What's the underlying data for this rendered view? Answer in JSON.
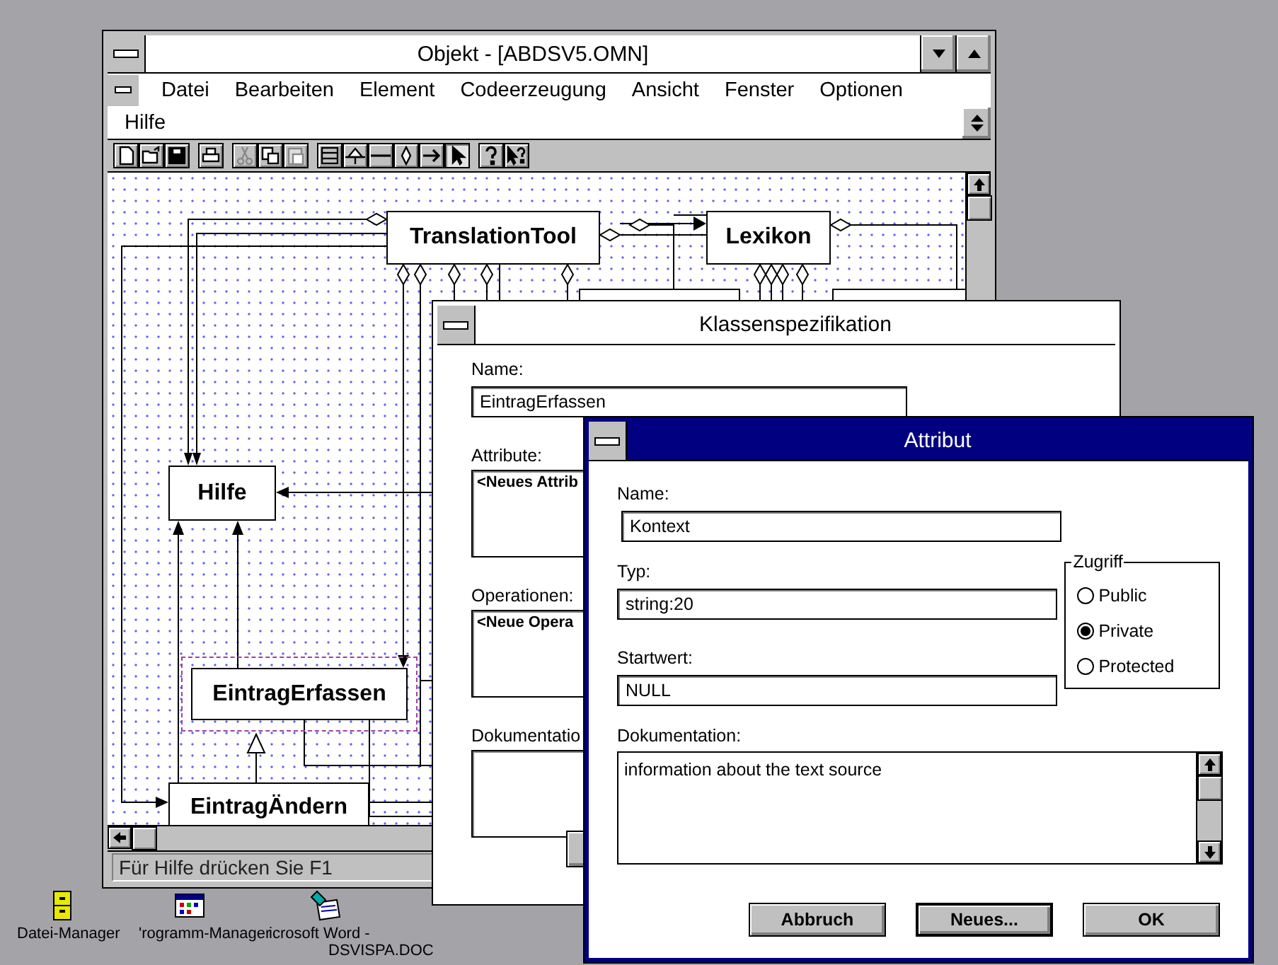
{
  "main_window": {
    "title": "Objekt - [ABDSV5.OMN]",
    "menu": [
      {
        "label": "Datei"
      },
      {
        "label": "Bearbeiten"
      },
      {
        "label": "Element"
      },
      {
        "label": "Codeerzeugung"
      },
      {
        "label": "Ansicht"
      },
      {
        "label": "Fenster"
      },
      {
        "label": "Optionen"
      },
      {
        "label": "Hilfe"
      }
    ],
    "toolbar": [
      [
        {
          "kind": "new",
          "disabled": false,
          "selected": false
        },
        {
          "kind": "open",
          "disabled": false,
          "selected": false
        },
        {
          "kind": "save",
          "disabled": false,
          "selected": false
        }
      ],
      [
        {
          "kind": "print",
          "disabled": false,
          "selected": false
        }
      ],
      [
        {
          "kind": "cut",
          "disabled": true,
          "selected": false
        },
        {
          "kind": "copy",
          "disabled": false,
          "selected": false
        },
        {
          "kind": "paste",
          "disabled": true,
          "selected": false
        }
      ],
      [
        {
          "kind": "class",
          "disabled": false,
          "selected": false
        },
        {
          "kind": "inherit",
          "disabled": false,
          "selected": false
        },
        {
          "kind": "line",
          "disabled": false,
          "selected": false
        },
        {
          "kind": "aggregate",
          "disabled": false,
          "selected": false
        },
        {
          "kind": "arrow",
          "disabled": false,
          "selected": false
        },
        {
          "kind": "pointer",
          "disabled": false,
          "selected": true
        }
      ],
      [
        {
          "kind": "help",
          "disabled": false,
          "selected": false
        },
        {
          "kind": "context-help",
          "disabled": false,
          "selected": false
        }
      ]
    ],
    "diagram": {
      "classes": [
        {
          "name": "TranslationTool",
          "selected": false
        },
        {
          "name": "Lexikon",
          "selected": false
        },
        {
          "name": "Hilfe",
          "selected": false
        },
        {
          "name": "EintragErfassen",
          "selected": true
        },
        {
          "name": "EintragÄndern",
          "selected": false
        }
      ]
    },
    "status_bar": "Für Hilfe drücken Sie F1"
  },
  "class_dialog": {
    "title": "Klassenspezifikation",
    "name_label": "Name:",
    "name_value": "EintragErfassen",
    "attributes_label": "Attribute:",
    "attributes": [
      "<Neues Attrib"
    ],
    "operations_label": "Operationen:",
    "operations": [
      "<Neue Opera"
    ],
    "documentation_label": "Dokumentatio"
  },
  "attribute_dialog": {
    "title": "Attribut",
    "name_label": "Name:",
    "name_value": "Kontext",
    "type_label": "Typ:",
    "type_value": "string:20",
    "initial_label": "Startwert:",
    "initial_value": "NULL",
    "access_label": "Zugriff",
    "access": [
      {
        "label": "Public",
        "selected": false
      },
      {
        "label": "Private",
        "selected": true
      },
      {
        "label": "Protected",
        "selected": false
      }
    ],
    "documentation_label": "Dokumentation:",
    "documentation": "information about the text source",
    "buttons": [
      {
        "label": "Abbruch",
        "default": false
      },
      {
        "label": "Neues...",
        "default": true
      },
      {
        "label": "OK",
        "default": false
      }
    ]
  },
  "desktop_icons": [
    {
      "kind": "file-manager",
      "label": "Datei-Manager"
    },
    {
      "kind": "program-manager",
      "label": "'rogramm-Manager"
    },
    {
      "kind": "word",
      "label": "icrosoft Word -",
      "label_2": "DSVISPA.DOC"
    }
  ]
}
